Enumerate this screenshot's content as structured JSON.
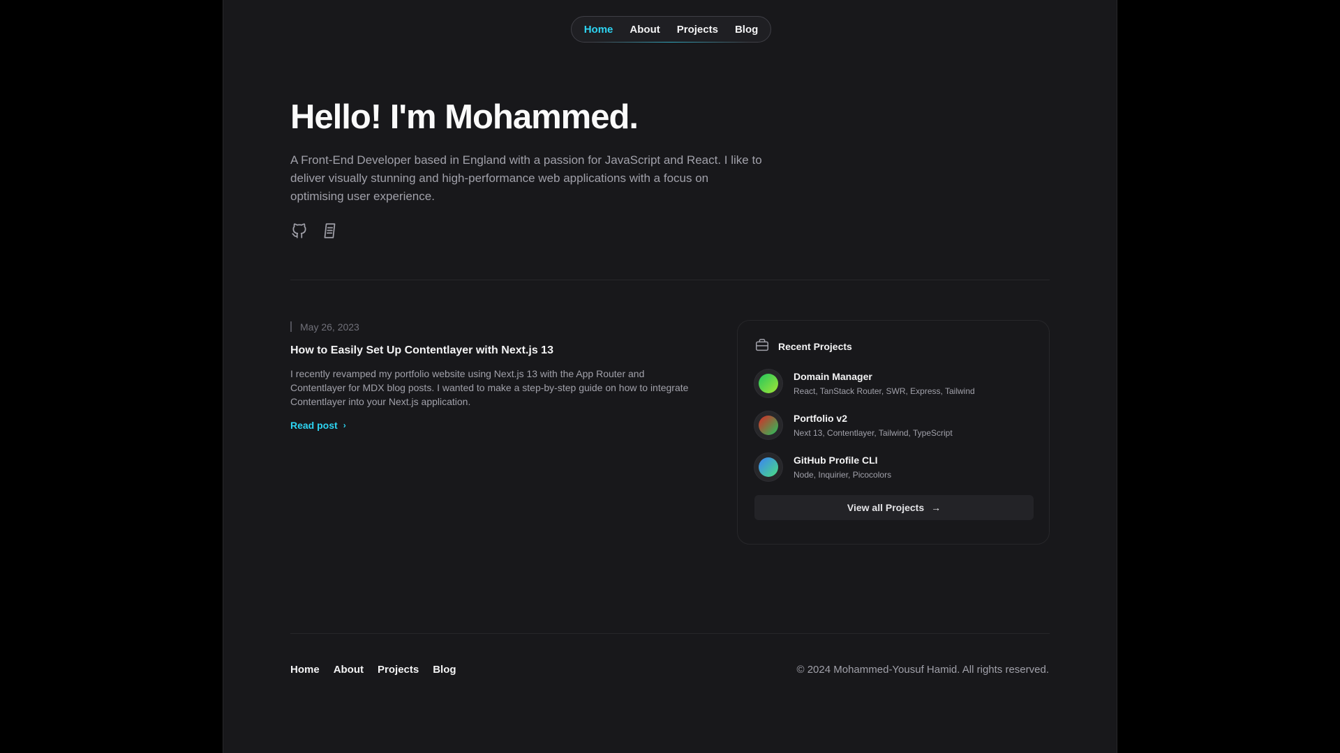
{
  "nav": {
    "items": [
      {
        "label": "Home",
        "active": true
      },
      {
        "label": "About"
      },
      {
        "label": "Projects"
      },
      {
        "label": "Blog"
      }
    ]
  },
  "hero": {
    "title": "Hello! I'm Mohammed.",
    "description": "A Front-End Developer based in England with a passion for JavaScript and React. I like to deliver visually stunning and high-performance web applications with a focus on optimising user experience.",
    "socials": [
      {
        "icon": "github-icon"
      },
      {
        "icon": "resume-icon"
      }
    ]
  },
  "post": {
    "date": "May 26, 2023",
    "title": "How to Easily Set Up Contentlayer with Next.js 13",
    "excerpt": "I recently revamped my portfolio website using Next.js 13 with the App Router and Contentlayer for MDX blog posts. I wanted to make a step-by-step guide on how to integrate Contentlayer into your Next.js application.",
    "read_label": "Read post"
  },
  "projects": {
    "heading": "Recent Projects",
    "items": [
      {
        "name": "Domain Manager",
        "tech": "React, TanStack Router, SWR, Express, Tailwind",
        "color_from": "#22c55e",
        "color_to": "#a3e635"
      },
      {
        "name": "Portfolio v2",
        "tech": "Next 13, Contentlayer, Tailwind, TypeScript",
        "color_from": "#dc2626",
        "color_to": "#22c55e"
      },
      {
        "name": "GitHub Profile CLI",
        "tech": "Node, Inquirier, Picocolors",
        "color_from": "#3b82f6",
        "color_to": "#4ade80"
      }
    ],
    "view_all_label": "View all Projects"
  },
  "footer": {
    "nav": [
      "Home",
      "About",
      "Projects",
      "Blog"
    ],
    "copyright": "© 2024 Mohammed-Yousuf Hamid. All rights reserved."
  },
  "colors": {
    "accent": "#2dd4f2",
    "background": "#18181b"
  }
}
